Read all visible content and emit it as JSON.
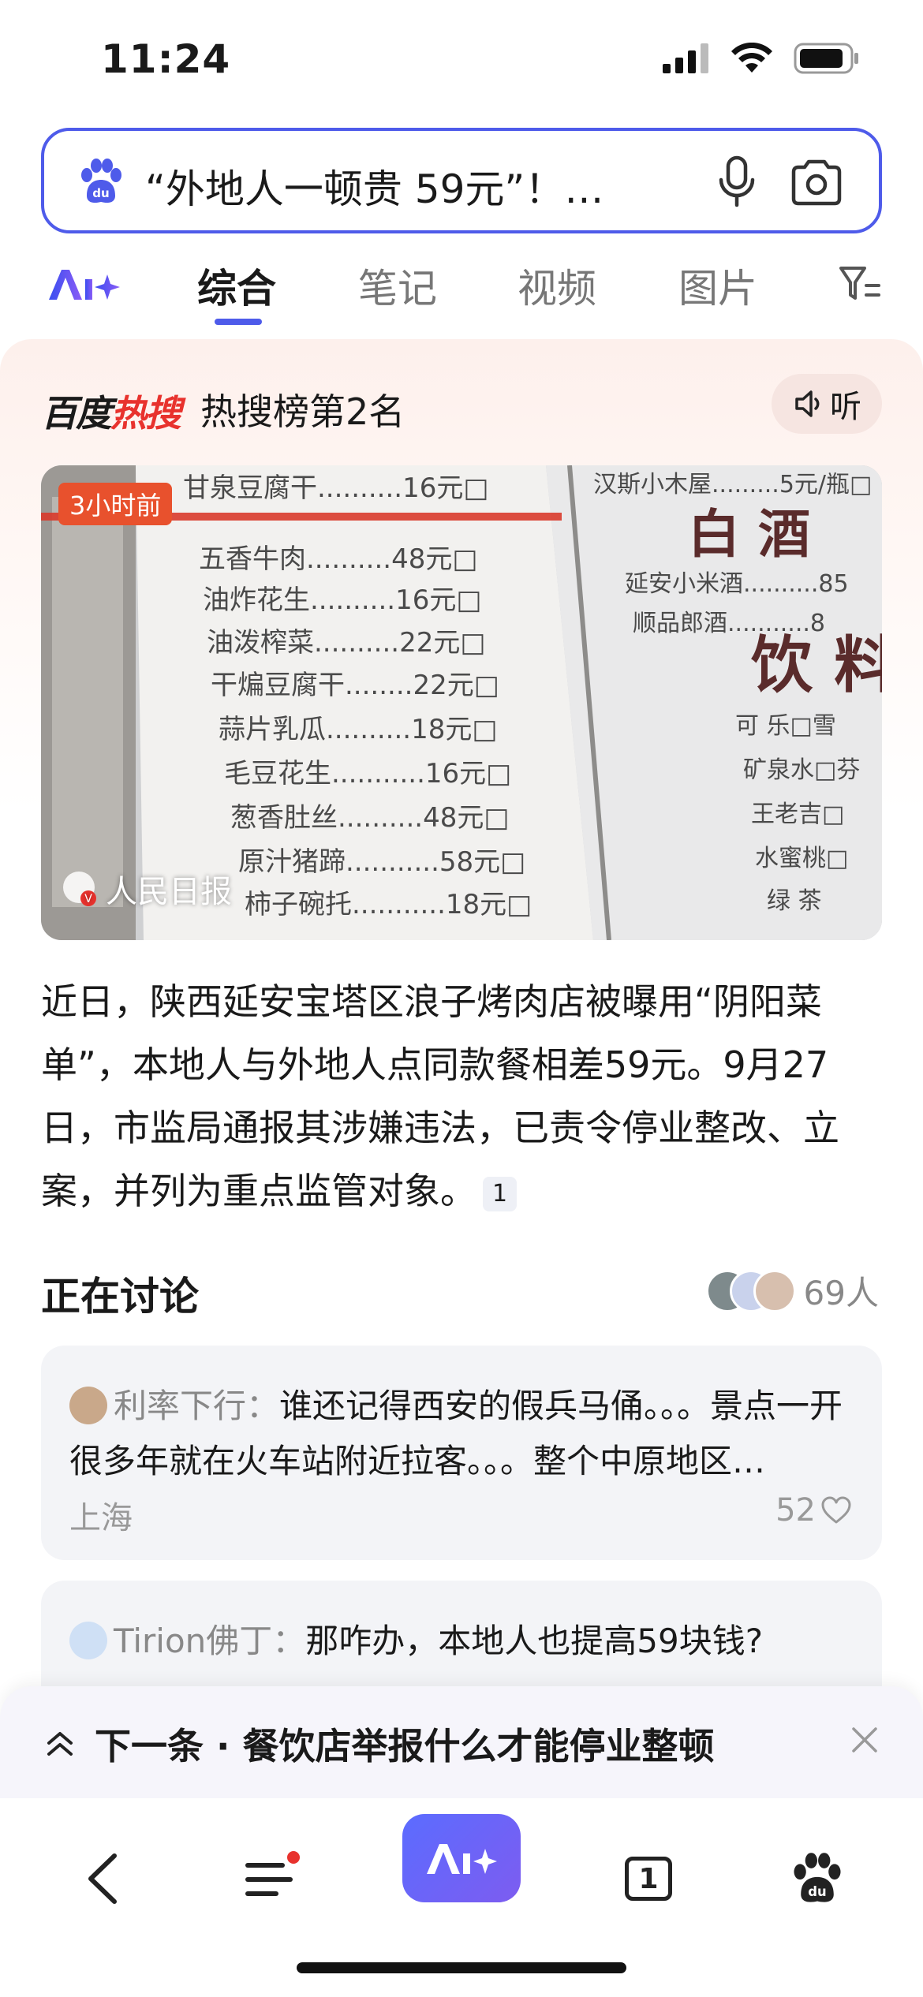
{
  "status_bar": {
    "time": "11:24"
  },
  "search": {
    "query": "“外地人一顿贵 59元”！…"
  },
  "tabs": {
    "ai_label": "Ai",
    "items": [
      {
        "label": "综合",
        "active": true
      },
      {
        "label": "笔记",
        "active": false
      },
      {
        "label": "视频",
        "active": false
      },
      {
        "label": "图片",
        "active": false
      }
    ]
  },
  "hot": {
    "brand_black": "百度",
    "brand_red": "热搜",
    "rank_text": "热搜榜第2名",
    "listen_label": "听",
    "image": {
      "time_badge": "3小时前",
      "source": "人民日报"
    },
    "summary": "近日，陕西延安宝塔区浪子烤肉店被曝用“阴阳菜单”，本地人与外地人点同款餐相差59元。9月27日，市监局通报其涉嫌违法，已责令停业整改、立案，并列为重点监管对象。",
    "citation": "1"
  },
  "discussion": {
    "title": "正在讨论",
    "count": "69人",
    "comments": [
      {
        "user": "利率下行：",
        "text": "谁还记得西安的假兵马俑。。。景点一开很多年就在火车站附近拉客。。。整个中原地区…",
        "location": "上海",
        "likes": "52"
      },
      {
        "user": "Tirion佛丁：",
        "text": "那咋办，本地人也提高59块钱?"
      }
    ]
  },
  "next_banner": {
    "text": "下一条 · 餐饮店举报什么才能停业整顿"
  },
  "bottom_nav": {
    "ai_label": "Ai",
    "tab_count": "1"
  },
  "colors": {
    "accent": "#4e5bea",
    "hot_red": "#e8322d",
    "badge": "#e8512d"
  }
}
